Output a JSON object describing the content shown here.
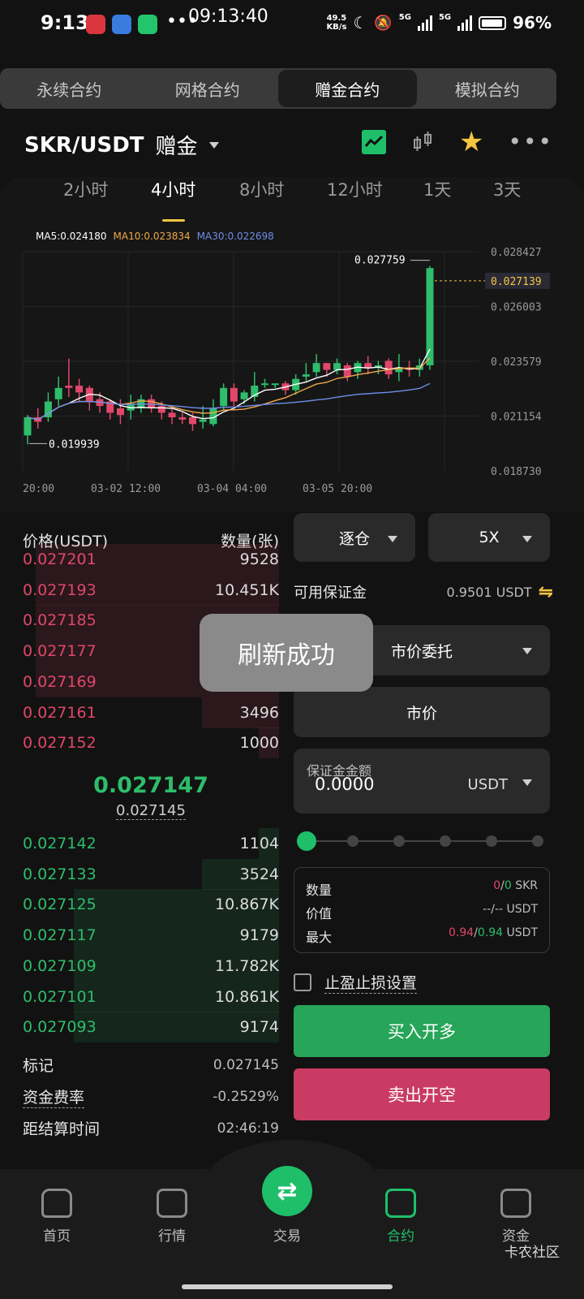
{
  "status": {
    "time": "9:13",
    "more": "•••",
    "clock": "09:13:40",
    "speed_top": "49.5",
    "speed_bottom": "KB/s",
    "net1": "5G",
    "net2": "5G",
    "battery": "96%"
  },
  "segment_tabs": [
    "永续合约",
    "网格合约",
    "赠金合约",
    "模拟合约"
  ],
  "pair": {
    "name": "SKR/USDT",
    "tag": "赠金"
  },
  "timeframes": [
    "2小时",
    "4小时",
    "8小时",
    "12小时",
    "1天",
    "3天"
  ],
  "ma": {
    "ma5": "MA5:0.024180",
    "ma10": "MA10:0.023834",
    "ma30": "MA30:0.022698"
  },
  "chart_data": {
    "type": "candlestick",
    "y_ticks": [
      "0.028427",
      "0.027139",
      "0.026003",
      "0.023579",
      "0.021154",
      "0.018730"
    ],
    "x_ticks": [
      "20:00",
      "03-02  12:00",
      "03-04  04:00",
      "03-05  20:00"
    ],
    "high_label": "0.027759",
    "low_label": "0.019939",
    "last_price": "0.027139",
    "ylim": [
      0.01873,
      0.028427
    ],
    "candles": [
      [
        0.0203,
        0.0211,
        0.0199,
        0.0212
      ],
      [
        0.0211,
        0.0209,
        0.0206,
        0.0215
      ],
      [
        0.0211,
        0.0218,
        0.0209,
        0.0222
      ],
      [
        0.0219,
        0.0224,
        0.0216,
        0.0229
      ],
      [
        0.0225,
        0.0224,
        0.022,
        0.0237
      ],
      [
        0.0225,
        0.0222,
        0.0218,
        0.0228
      ],
      [
        0.0224,
        0.0218,
        0.0214,
        0.0225
      ],
      [
        0.0219,
        0.0216,
        0.0213,
        0.0222
      ],
      [
        0.0218,
        0.0213,
        0.021,
        0.0219
      ],
      [
        0.0215,
        0.0212,
        0.0208,
        0.0219
      ],
      [
        0.0214,
        0.0217,
        0.021,
        0.0221
      ],
      [
        0.0215,
        0.0219,
        0.0213,
        0.0221
      ],
      [
        0.0219,
        0.0215,
        0.0213,
        0.0221
      ],
      [
        0.0216,
        0.0213,
        0.021,
        0.0218
      ],
      [
        0.0213,
        0.0211,
        0.0208,
        0.0215
      ],
      [
        0.0211,
        0.021,
        0.0208,
        0.0213
      ],
      [
        0.0211,
        0.0208,
        0.0205,
        0.0213
      ],
      [
        0.0209,
        0.021,
        0.0206,
        0.0216
      ],
      [
        0.0208,
        0.0215,
        0.0207,
        0.0219
      ],
      [
        0.0216,
        0.0224,
        0.0214,
        0.0226
      ],
      [
        0.0224,
        0.0218,
        0.0216,
        0.0226
      ],
      [
        0.0219,
        0.0222,
        0.0217,
        0.0223
      ],
      [
        0.022,
        0.0225,
        0.0218,
        0.0231
      ],
      [
        0.0226,
        0.0226,
        0.0224,
        0.0228
      ],
      [
        0.0226,
        0.0226,
        0.0224,
        0.0226
      ],
      [
        0.0226,
        0.0223,
        0.0221,
        0.0227
      ],
      [
        0.0223,
        0.0228,
        0.0221,
        0.023
      ],
      [
        0.0229,
        0.023,
        0.0227,
        0.0235
      ],
      [
        0.0231,
        0.0235,
        0.0229,
        0.0239
      ],
      [
        0.0235,
        0.0232,
        0.0229,
        0.0235
      ],
      [
        0.0232,
        0.0235,
        0.023,
        0.0237
      ],
      [
        0.0234,
        0.0229,
        0.0227,
        0.0235
      ],
      [
        0.0231,
        0.0235,
        0.0228,
        0.0236
      ],
      [
        0.0235,
        0.0233,
        0.023,
        0.0238
      ],
      [
        0.0233,
        0.0234,
        0.023,
        0.0236
      ],
      [
        0.0236,
        0.023,
        0.0228,
        0.0237
      ],
      [
        0.0231,
        0.0233,
        0.0227,
        0.0239
      ],
      [
        0.0233,
        0.0232,
        0.0229,
        0.0236
      ],
      [
        0.0232,
        0.0234,
        0.0229,
        0.0237
      ],
      [
        0.0234,
        0.0277,
        0.0232,
        0.0278
      ]
    ]
  },
  "orderbook": {
    "header_price": "价格(USDT)",
    "header_qty": "数量(张)",
    "asks": [
      {
        "price": "0.027201",
        "qty": "9528",
        "depth": 0.95
      },
      {
        "price": "0.027193",
        "qty": "10.451K",
        "depth": 0.95
      },
      {
        "price": "0.027185",
        "qty": "",
        "depth": 0.95
      },
      {
        "price": "0.027177",
        "qty": "",
        "depth": 0.95
      },
      {
        "price": "0.027169",
        "qty": "",
        "depth": 0.95
      },
      {
        "price": "0.027161",
        "qty": "3496",
        "depth": 0.3
      },
      {
        "price": "0.027152",
        "qty": "1000",
        "depth": 0.08
      }
    ],
    "mid_price": "0.027147",
    "mark_price": "0.027145",
    "bids": [
      {
        "price": "0.027142",
        "qty": "1104",
        "depth": 0.08
      },
      {
        "price": "0.027133",
        "qty": "3524",
        "depth": 0.3
      },
      {
        "price": "0.027125",
        "qty": "10.867K",
        "depth": 0.8
      },
      {
        "price": "0.027117",
        "qty": "9179",
        "depth": 0.8
      },
      {
        "price": "0.027109",
        "qty": "11.782K",
        "depth": 0.8
      },
      {
        "price": "0.027101",
        "qty": "10.861K",
        "depth": 0.8
      },
      {
        "price": "0.027093",
        "qty": "9174",
        "depth": 0.8
      }
    ],
    "info": [
      {
        "key": "标记",
        "value": "0.027145"
      },
      {
        "key": "资金费率",
        "value": "-0.2529%"
      },
      {
        "key": "距结算时间",
        "value": "02:46:19"
      }
    ]
  },
  "form": {
    "margin_mode": "逐仓",
    "leverage": "5X",
    "avail_label": "可用保证金",
    "avail_value": "0.9501 USDT",
    "order_type": "市价委托",
    "price_mode": "市价",
    "margin_label": "保证金金额",
    "margin_value": "0.0000",
    "margin_unit": "USDT",
    "slider_percent": 0,
    "stats": {
      "qty_label": "数量",
      "qty_a": "0",
      "qty_sep": "/",
      "qty_b": "0",
      "qty_unit": "SKR",
      "value_label": "价值",
      "value_text": "--/-- USDT",
      "max_label": "最大",
      "max_a": "0.94",
      "max_sep": "/",
      "max_b": "0.94",
      "max_unit": "USDT"
    },
    "tpsl_label": "止盈止损设置",
    "buy_label": "买入开多",
    "sell_label": "卖出开空"
  },
  "toast": "刷新成功",
  "nav": {
    "home": "首页",
    "market": "行情",
    "trade": "交易",
    "contract": "合约",
    "assets": "资金"
  },
  "watermark": "卡农社区",
  "colors": {
    "up": "#2ebd6b",
    "down": "#e0476a",
    "accent": "#f5c542"
  }
}
